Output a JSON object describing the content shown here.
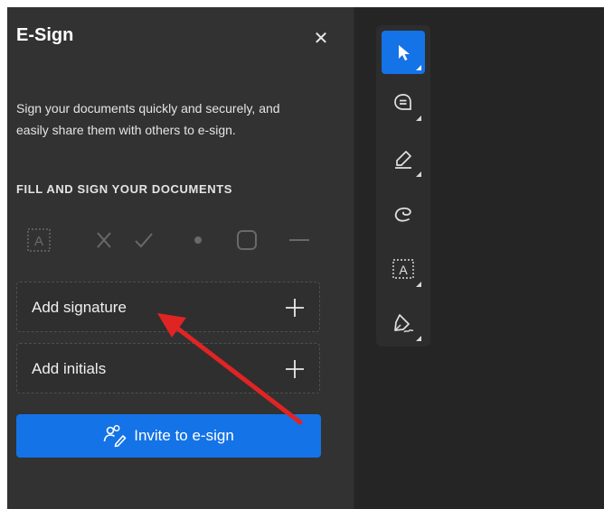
{
  "panel": {
    "title": "E-Sign",
    "description": "Sign your documents quickly and securely, and easily share them with others to e-sign.",
    "section_heading": "FILL AND SIGN YOUR DOCUMENTS",
    "fill_tools": [
      "text-field-icon",
      "cross-icon",
      "checkmark-icon",
      "dot-icon",
      "rounded-box-icon",
      "line-icon"
    ],
    "add_signature_label": "Add signature",
    "add_initials_label": "Add initials",
    "invite_label": "Invite to e-sign"
  },
  "toolbar": {
    "tools": [
      "select-pointer-icon",
      "comment-icon",
      "highlight-pen-icon",
      "freehand-draw-icon",
      "text-field-icon",
      "sign-pen-icon"
    ],
    "active_tool": "select-pointer-icon"
  },
  "annotation": {
    "arrow_color": "#e02424"
  },
  "colors": {
    "accent": "#1473e6",
    "panel_bg": "#323232",
    "canvas_bg": "#252525"
  }
}
